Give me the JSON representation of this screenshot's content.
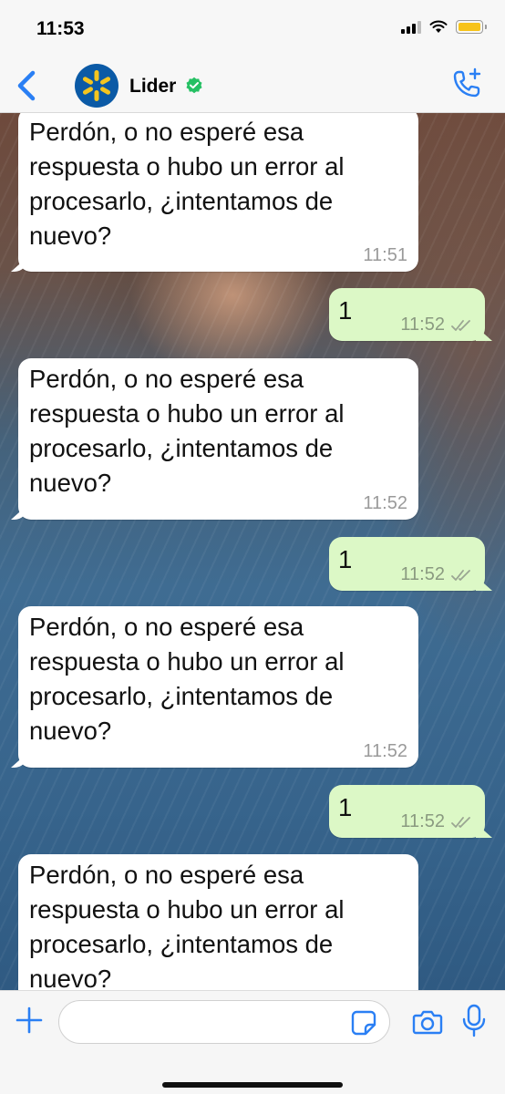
{
  "status_bar": {
    "time": "11:53"
  },
  "header": {
    "contact_name": "Lider",
    "verified": true,
    "back_icon": "chevron-left-icon",
    "call_icon": "phone-plus-icon",
    "accent_color": "#2a7ff4"
  },
  "messages": [
    {
      "direction": "in",
      "text": "Perdón, o no esperé esa respuesta o hubo un error al procesarlo, ¿intentamos de nuevo?",
      "time": "11:51"
    },
    {
      "direction": "out",
      "text": "1",
      "time": "11:52",
      "status": "read-double-check"
    },
    {
      "direction": "in",
      "text": "Perdón, o no esperé esa respuesta o hubo un error al procesarlo, ¿intentamos de nuevo?",
      "time": "11:52"
    },
    {
      "direction": "out",
      "text": "1",
      "time": "11:52",
      "status": "read-double-check"
    },
    {
      "direction": "in",
      "text": "Perdón, o no esperé esa respuesta o hubo un error al procesarlo, ¿intentamos de nuevo?",
      "time": "11:52"
    },
    {
      "direction": "out",
      "text": "1",
      "time": "11:52",
      "status": "read-double-check"
    },
    {
      "direction": "in",
      "text": "Perdón, o no esperé esa respuesta o hubo un error al procesarlo, ¿intentamos de nuevo?",
      "time": ""
    }
  ],
  "input_bar": {
    "placeholder": "",
    "icons": [
      "plus-icon",
      "sticker-icon",
      "camera-icon",
      "microphone-icon"
    ]
  },
  "colors": {
    "incoming_bubble": "#ffffff",
    "outgoing_bubble": "#dcf8c6",
    "verified_badge": "#25c063",
    "battery": "#f7c31a"
  }
}
